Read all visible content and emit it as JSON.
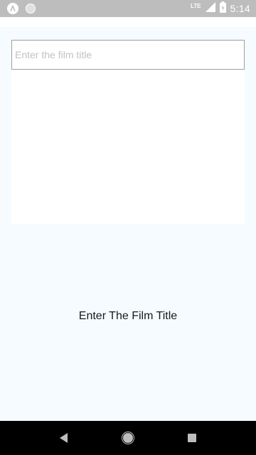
{
  "status_bar": {
    "network": "LTE",
    "time": "5:14",
    "icons": [
      "app-logo-icon",
      "status-dot-icon",
      "lte-signal-icon",
      "battery-icon"
    ]
  },
  "search": {
    "placeholder": "Enter the film title",
    "value": ""
  },
  "main": {
    "prompt": "Enter The Film Title"
  },
  "nav_bar": {
    "icons": [
      "back-icon",
      "home-icon",
      "recent-apps-icon"
    ]
  },
  "colors": {
    "status_bar": "#bdbdbd",
    "background": "#f5fbff",
    "card": "#ffffff",
    "nav_bar": "#000000"
  }
}
